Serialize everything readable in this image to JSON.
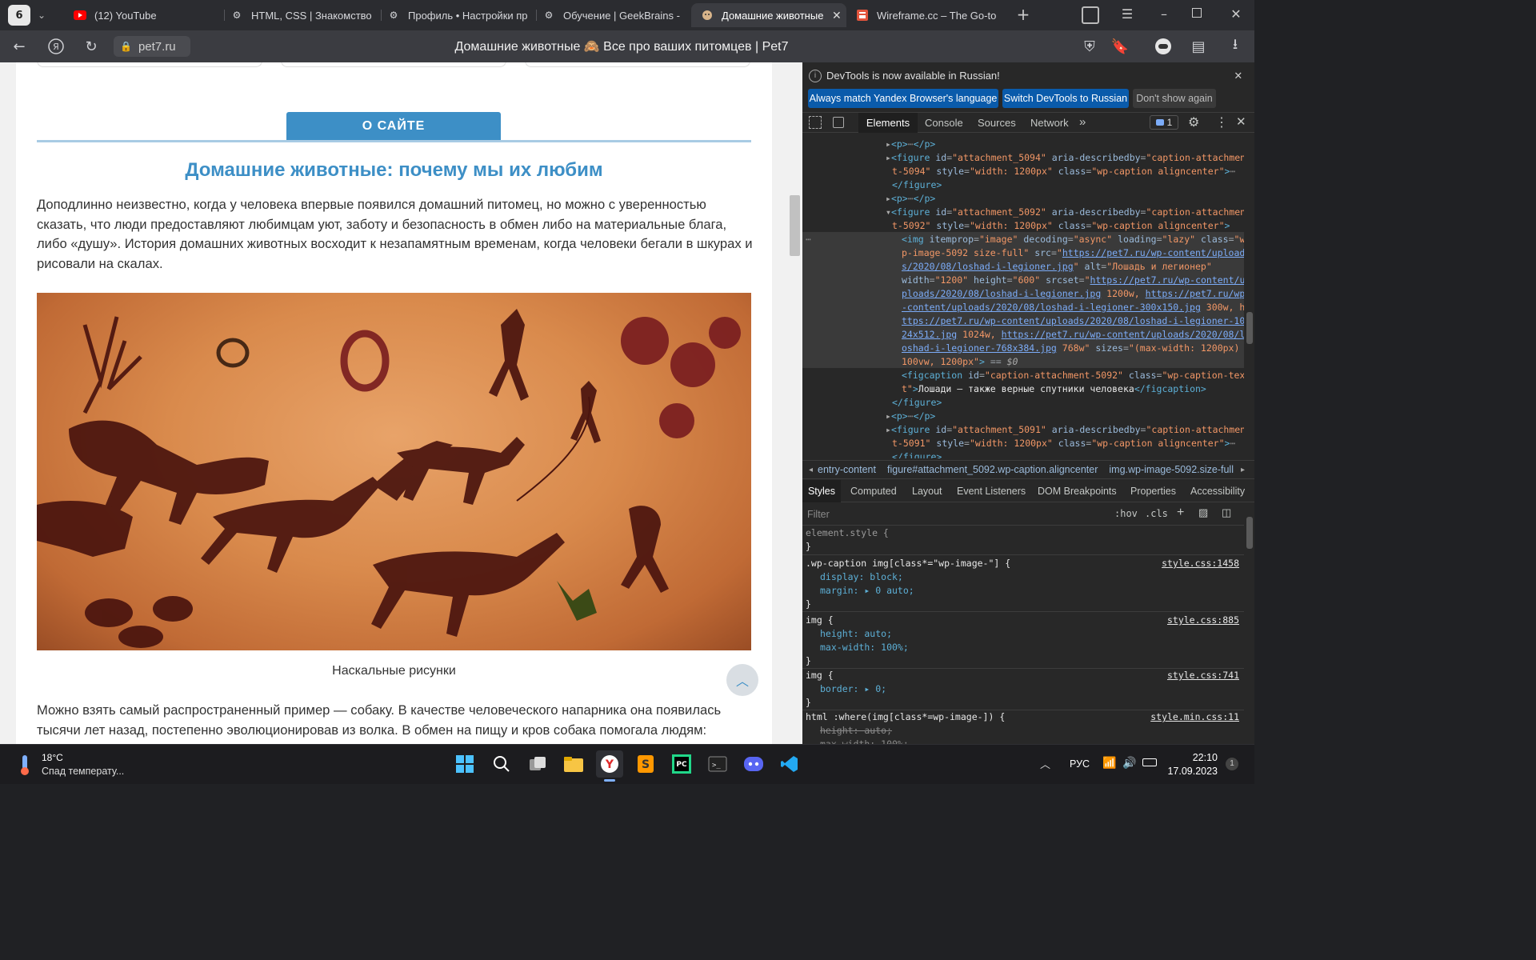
{
  "browser": {
    "tab_counter": "6",
    "tabs": [
      {
        "title": "(12) YouTube"
      },
      {
        "title": "HTML, CSS | Знакомство"
      },
      {
        "title": "Профиль • Настройки пр"
      },
      {
        "title": "Обучение | GeekBrains -"
      },
      {
        "title": "Домашние животные"
      },
      {
        "title": "Wireframe.cc – The Go-to"
      }
    ],
    "address": "pet7.ru",
    "page_title": "Домашние животные 🙈 Все про ваших питомцев | Pet7"
  },
  "page": {
    "section_badge": "О САЙТЕ",
    "heading": "Домашние животные: почему мы их любим",
    "paragraph1": "Доподлинно  неизвестно, когда у человека впервые появился домашний питомец, но можно с уверенностью сказать, что люди предоставляют любимцам уют, заботу и безопасность в обмен либо на материальные блага, либо «душу». История домашних животных восходит к незапамятным временам, когда человеки бегали в шкурах и рисовали на скалах.",
    "caption": "Наскальные рисунки",
    "paragraph2": "Можно взять самый распространенный пример — собаку. В качестве человеческого напарника она появилась тысячи лет назад, постепенно эволюционировав из волка. В обмен на пищу и кров собака помогала людям:"
  },
  "devtools": {
    "info_text": "DevTools is now available in Russian!",
    "btn_match": "Always match Yandex Browser's language",
    "btn_switch": "Switch DevTools to Russian",
    "btn_dont": "Don't show again",
    "tabs": [
      "Elements",
      "Console",
      "Sources",
      "Network"
    ],
    "issues_count": "1",
    "breadcrumb": [
      "entry-content",
      "figure#attachment_5092.wp-caption.aligncenter",
      "img.wp-image-5092.size-full"
    ],
    "style_tabs": [
      "Styles",
      "Computed",
      "Layout",
      "Event Listeners",
      "DOM Breakpoints",
      "Properties",
      "Accessibility"
    ],
    "filter_placeholder": "Filter",
    "hov": ":hov",
    "cls": ".cls",
    "rules": [
      {
        "selector": "element.style {",
        "source": "",
        "props": []
      },
      {
        "selector": ".wp-caption img[class*=\"wp-image-\"] {",
        "source": "style.css:1458",
        "props": [
          "display: block;",
          "margin: ▸ 0 auto;"
        ]
      },
      {
        "selector": "img {",
        "source": "style.css:885",
        "props": [
          "height: auto;",
          "max-width: 100%;"
        ]
      },
      {
        "selector": "img {",
        "source": "style.css:741",
        "props": [
          "border: ▸ 0;"
        ]
      },
      {
        "selector": "html :where(img[class*=wp-image-]) {",
        "source": "style.min.css:11",
        "props": [
          "height: auto;",
          "max-width: 100%;"
        ]
      }
    ]
  },
  "taskbar": {
    "temperature": "18°C",
    "weather_text": "Спад температу...",
    "lang": "РУС",
    "time": "22:10",
    "date": "17.09.2023",
    "notif": "1"
  },
  "colors": {
    "accent": "#3d8fc6",
    "devtools_bg": "#282828",
    "link": "#7cacf8"
  }
}
